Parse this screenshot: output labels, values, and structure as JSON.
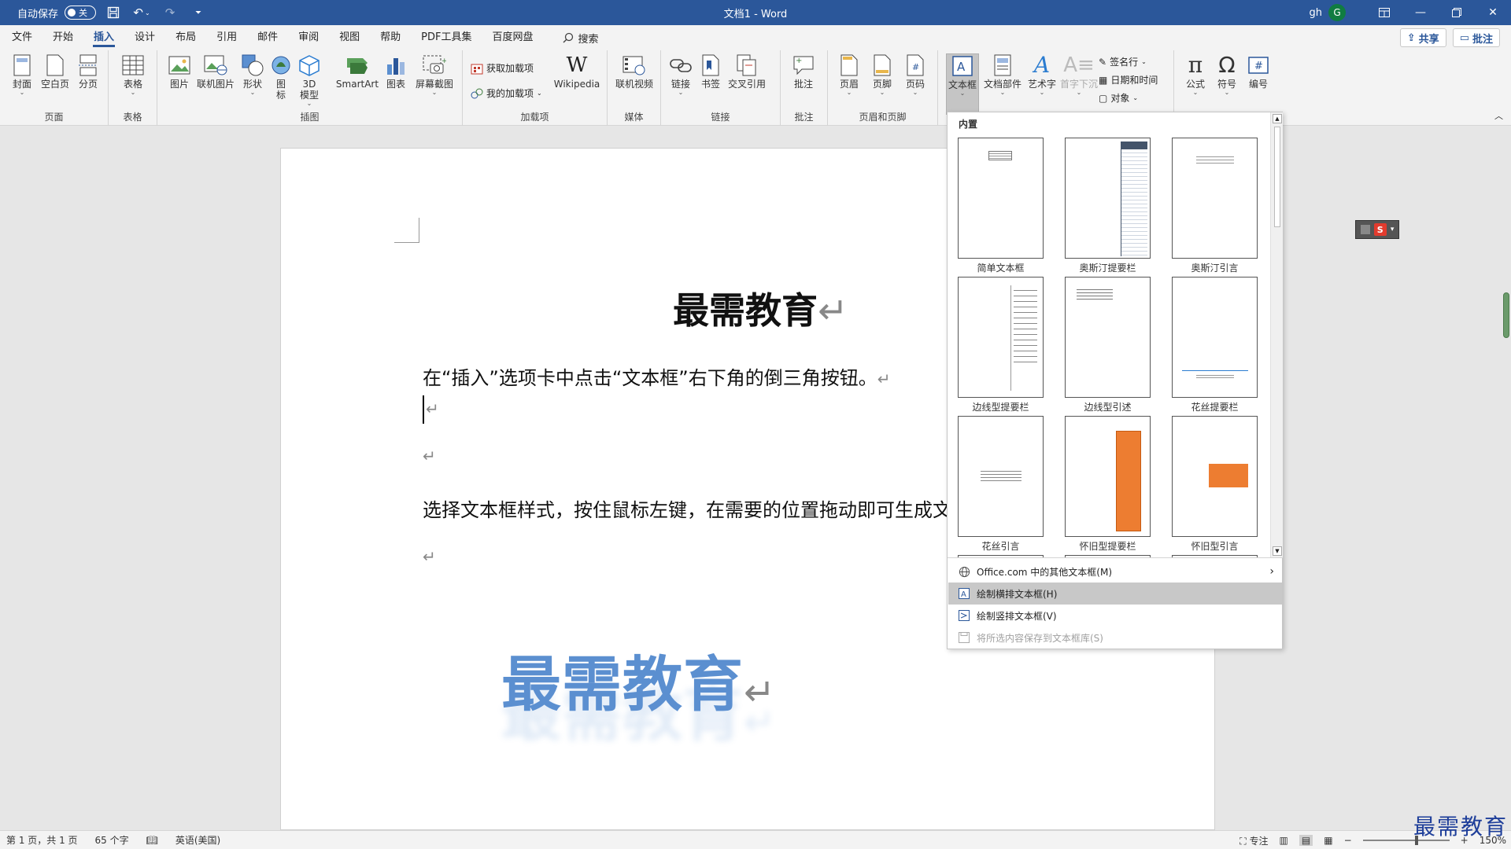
{
  "titlebar": {
    "autosave_label": "自动保存",
    "autosave_state": "关",
    "document_title": "文档1 - Word",
    "user_name": "gh",
    "user_initial": "G"
  },
  "tabs": [
    {
      "label": "文件"
    },
    {
      "label": "开始"
    },
    {
      "label": "插入",
      "active": true
    },
    {
      "label": "设计"
    },
    {
      "label": "布局"
    },
    {
      "label": "引用"
    },
    {
      "label": "邮件"
    },
    {
      "label": "审阅"
    },
    {
      "label": "视图"
    },
    {
      "label": "帮助"
    },
    {
      "label": "PDF工具集"
    },
    {
      "label": "百度网盘"
    }
  ],
  "search": {
    "label": "搜索"
  },
  "share_button": "共享",
  "comments_button": "批注",
  "ribbon": {
    "groups": {
      "pages": "页面",
      "tables": "表格",
      "illustrations": "插图",
      "addins": "加载项",
      "media": "媒体",
      "links": "链接",
      "comments": "批注",
      "header_footer": "页眉和页脚"
    },
    "buttons": {
      "cover": "封面",
      "blank": "空白页",
      "pagebreak": "分页",
      "table": "表格",
      "picture": "图片",
      "online_picture": "联机图片",
      "shapes": "形状",
      "icons": "图\n标",
      "model3d": "3D\n模型",
      "smartart": "SmartArt",
      "chart": "图表",
      "screenshot": "屏幕截图",
      "get_addins": "获取加载项",
      "my_addins": "我的加载项",
      "wikipedia": "Wikipedia",
      "online_video": "联机视频",
      "link": "链接",
      "bookmark": "书签",
      "crossref": "交叉引用",
      "comment": "批注",
      "header": "页眉",
      "footer": "页脚",
      "pagenum": "页码",
      "textbox": "文本框",
      "quickparts": "文档部件",
      "wordart": "艺术字",
      "dropcap": "首字下沉",
      "signature": "签名行",
      "datetime": "日期和时间",
      "object": "对象",
      "equation": "公式",
      "symbol": "符号",
      "number": "编号"
    }
  },
  "document": {
    "heading": "最需教育",
    "para1": "在“插入”选项卡中点击“文本框”右下角的倒三角按钮。",
    "para2": "选择文本框样式，按住鼠标左键，在需要的位置拖动即可生成文",
    "wordart": "最需教育",
    "paragraph_mark": "↵"
  },
  "gallery": {
    "header": "内置",
    "items": [
      {
        "caption": "简单文本框"
      },
      {
        "caption": "奥斯汀提要栏"
      },
      {
        "caption": "奥斯汀引言"
      },
      {
        "caption": "边线型提要栏"
      },
      {
        "caption": "边线型引述"
      },
      {
        "caption": "花丝提要栏"
      },
      {
        "caption": "花丝引言"
      },
      {
        "caption": "怀旧型提要栏"
      },
      {
        "caption": "怀旧型引言"
      }
    ],
    "menu": [
      {
        "label": "Office.com 中的其他文本框(M)",
        "has_arrow": true
      },
      {
        "label": "绘制横排文本框(H)",
        "hover": true
      },
      {
        "label": "绘制竖排文本框(V)"
      },
      {
        "label": "将所选内容保存到文本框库(S)",
        "disabled": true
      }
    ]
  },
  "statusbar": {
    "page": "第 1 页，共 1 页",
    "words": "65 个字",
    "language": "英语(美国)",
    "focus": "专注",
    "zoom": "150%"
  },
  "watermark": "最需教育",
  "colors": {
    "accent": "#2b579a",
    "wordart": "#5b8fd0",
    "orange": "#ed7d31"
  }
}
